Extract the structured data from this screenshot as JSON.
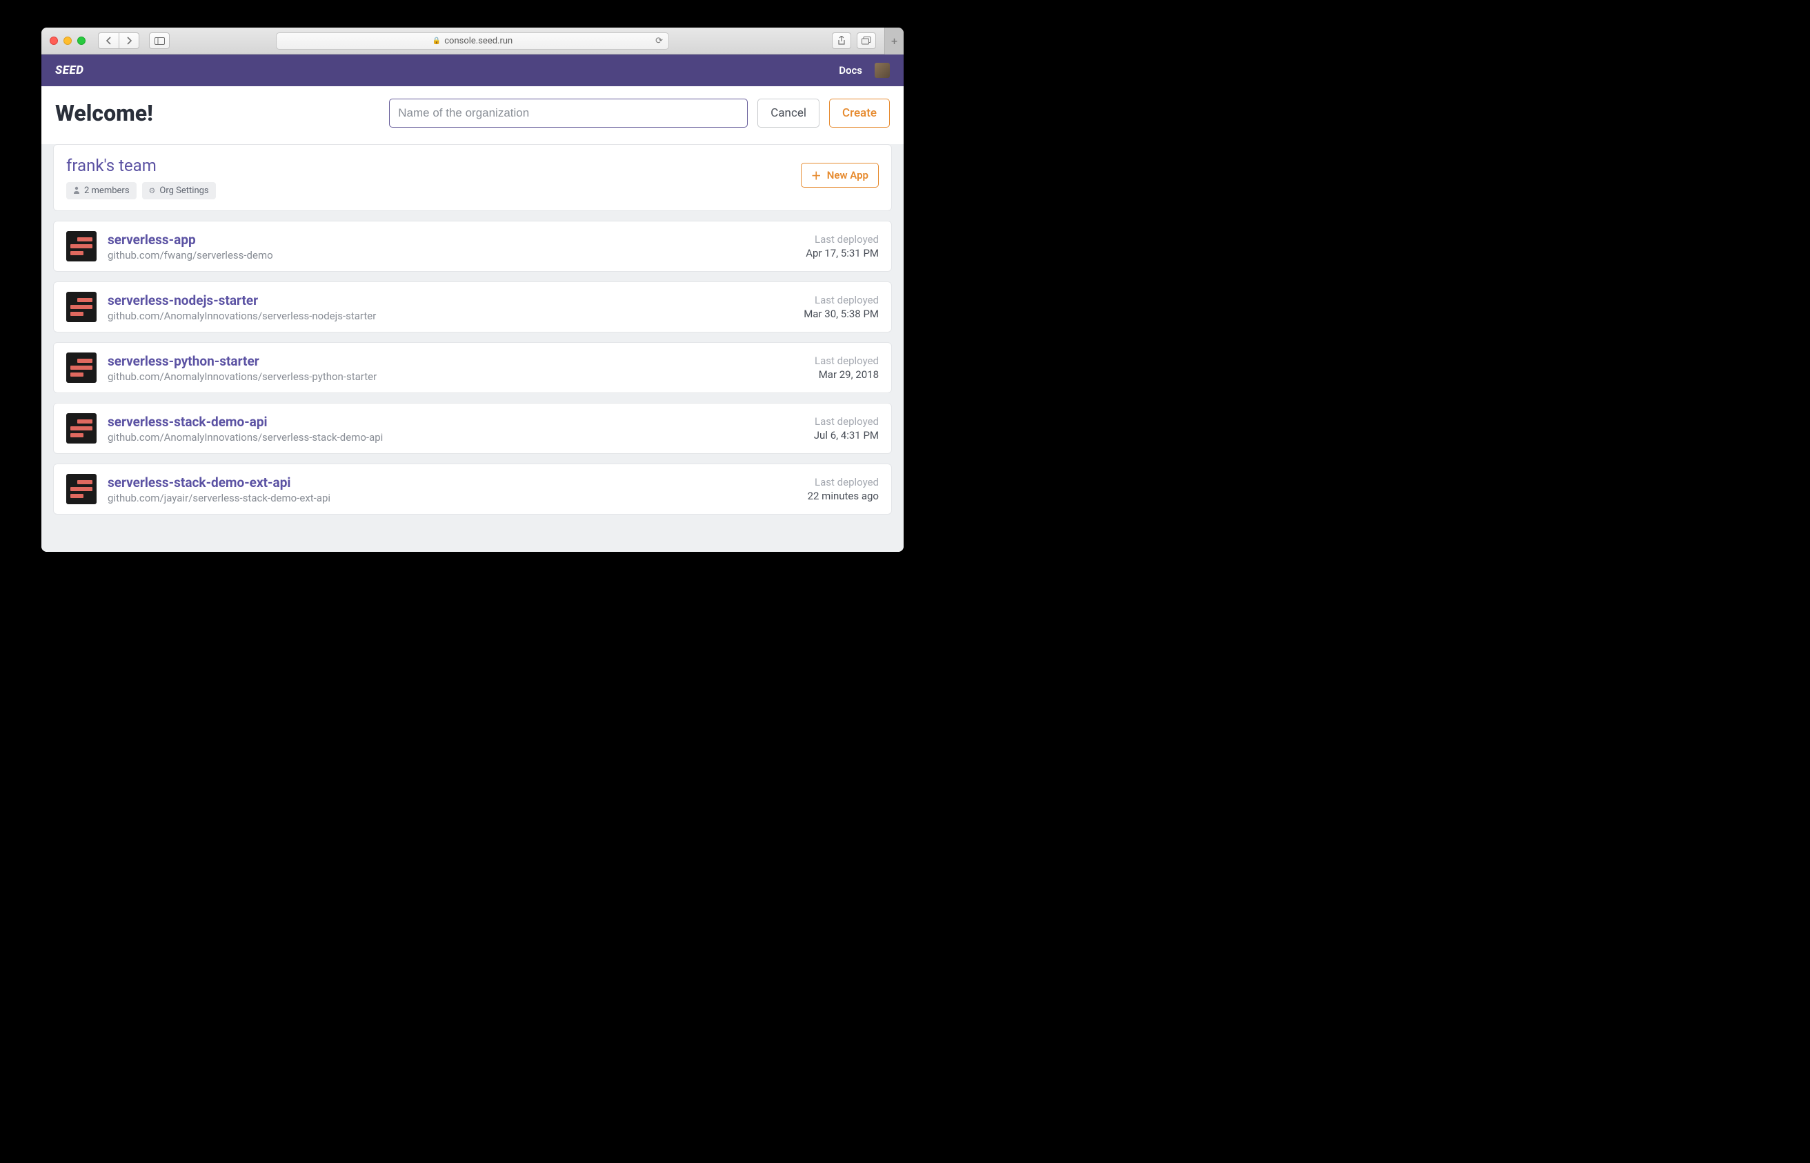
{
  "browser": {
    "url": "console.seed.run"
  },
  "header": {
    "logo": "SEED",
    "docs": "Docs"
  },
  "welcome_title": "Welcome!",
  "org_form": {
    "placeholder": "Name of the organization",
    "cancel": "Cancel",
    "create": "Create"
  },
  "team": {
    "name": "frank's team",
    "members_label": "2 members",
    "settings_label": "Org Settings",
    "new_app": "New App"
  },
  "deploy_label": "Last deployed",
  "apps": [
    {
      "name": "serverless-app",
      "repo": "github.com/fwang/serverless-demo",
      "deployed": "Apr 17, 5:31 PM"
    },
    {
      "name": "serverless-nodejs-starter",
      "repo": "github.com/AnomalyInnovations/serverless-nodejs-starter",
      "deployed": "Mar 30, 5:38 PM"
    },
    {
      "name": "serverless-python-starter",
      "repo": "github.com/AnomalyInnovations/serverless-python-starter",
      "deployed": "Mar 29, 2018"
    },
    {
      "name": "serverless-stack-demo-api",
      "repo": "github.com/AnomalyInnovations/serverless-stack-demo-api",
      "deployed": "Jul 6, 4:31 PM"
    },
    {
      "name": "serverless-stack-demo-ext-api",
      "repo": "github.com/jayair/serverless-stack-demo-ext-api",
      "deployed": "22 minutes ago"
    }
  ]
}
